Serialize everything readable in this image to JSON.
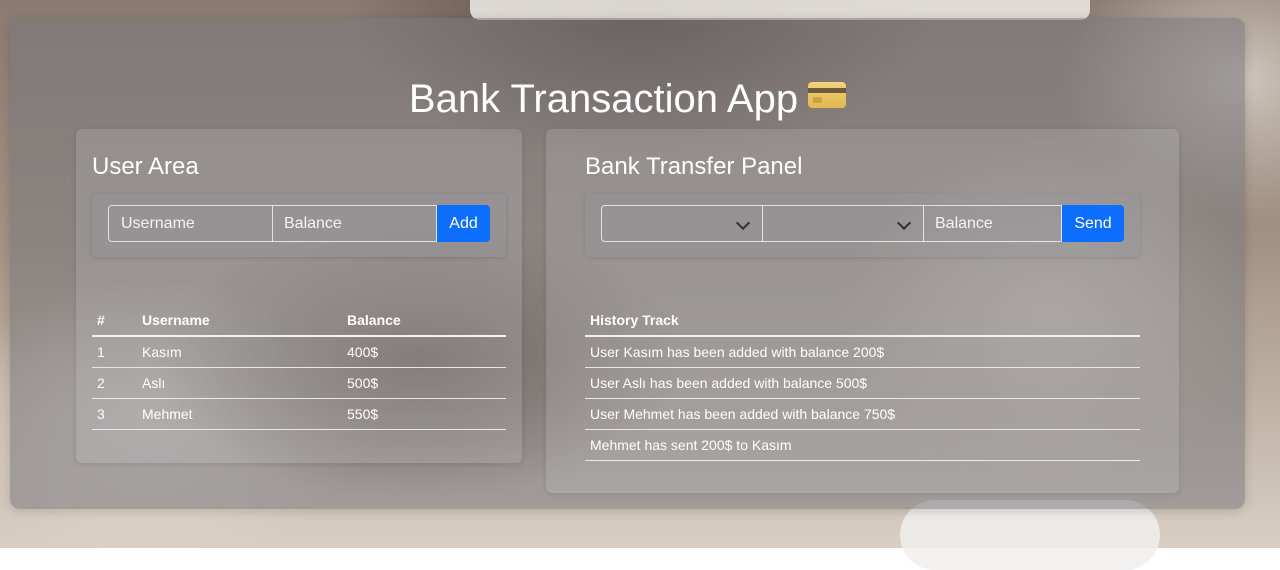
{
  "app": {
    "title": "Bank Transaction App"
  },
  "user_area": {
    "title": "User Area",
    "username_placeholder": "Username",
    "balance_placeholder": "Balance",
    "add_label": "Add",
    "table": {
      "headers": [
        "#",
        "Username",
        "Balance"
      ],
      "rows": [
        [
          "1",
          "Kasım",
          "400$"
        ],
        [
          "2",
          "Aslı",
          "500$"
        ],
        [
          "3",
          "Mehmet",
          "550$"
        ]
      ]
    }
  },
  "bank_transfer": {
    "title": "Bank Transfer Panel",
    "from_select_value": "",
    "to_select_value": "",
    "balance_placeholder": "Balance",
    "send_label": "Send",
    "history": {
      "header": "History Track",
      "rows": [
        "User Kasım has been added with balance 200$",
        "User Aslı has been added with balance 500$",
        "User Mehmet has been added with balance 750$",
        "Mehmet has sent 200$ to Kasım"
      ]
    }
  },
  "colors": {
    "primary_button": "#0d6efd"
  }
}
